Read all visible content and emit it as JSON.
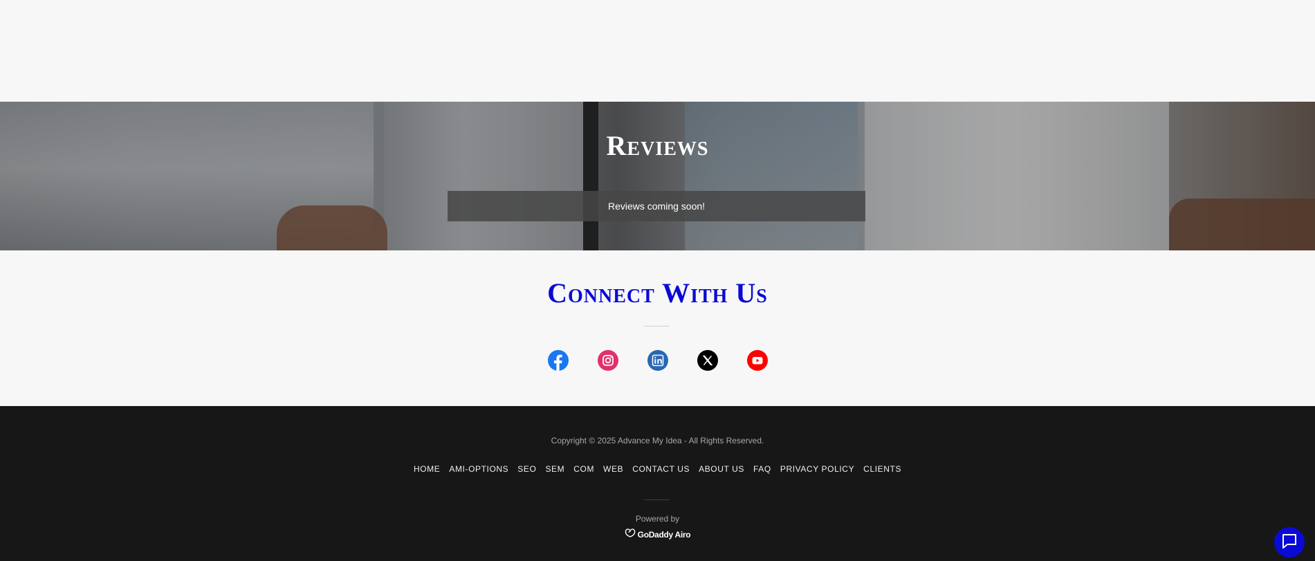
{
  "reviews": {
    "title": "Reviews",
    "message": "Reviews coming soon!"
  },
  "connect": {
    "title": "Connect With Us",
    "title_color": "#0a0ad6",
    "social": [
      {
        "name": "facebook-icon",
        "color": "#1877f2"
      },
      {
        "name": "instagram-icon",
        "color": "#e1306c"
      },
      {
        "name": "linkedin-icon",
        "color": "#2867b2"
      },
      {
        "name": "x-icon",
        "color": "#000000"
      },
      {
        "name": "youtube-icon",
        "color": "#ff0000"
      }
    ]
  },
  "footer": {
    "copyright": "Copyright © 2025 Advance My Idea - All Rights Reserved.",
    "nav": [
      "HOME",
      "AMI-OPTIONS",
      "SEO",
      "SEM",
      "COM",
      "WEB",
      "CONTACT US",
      "ABOUT US",
      "FAQ",
      "PRIVACY POLICY",
      "CLIENTS"
    ],
    "powered_by": "Powered by",
    "brand": "GoDaddy Airo"
  },
  "chat": {
    "icon": "chat-icon",
    "color": "#0a0ad6"
  }
}
